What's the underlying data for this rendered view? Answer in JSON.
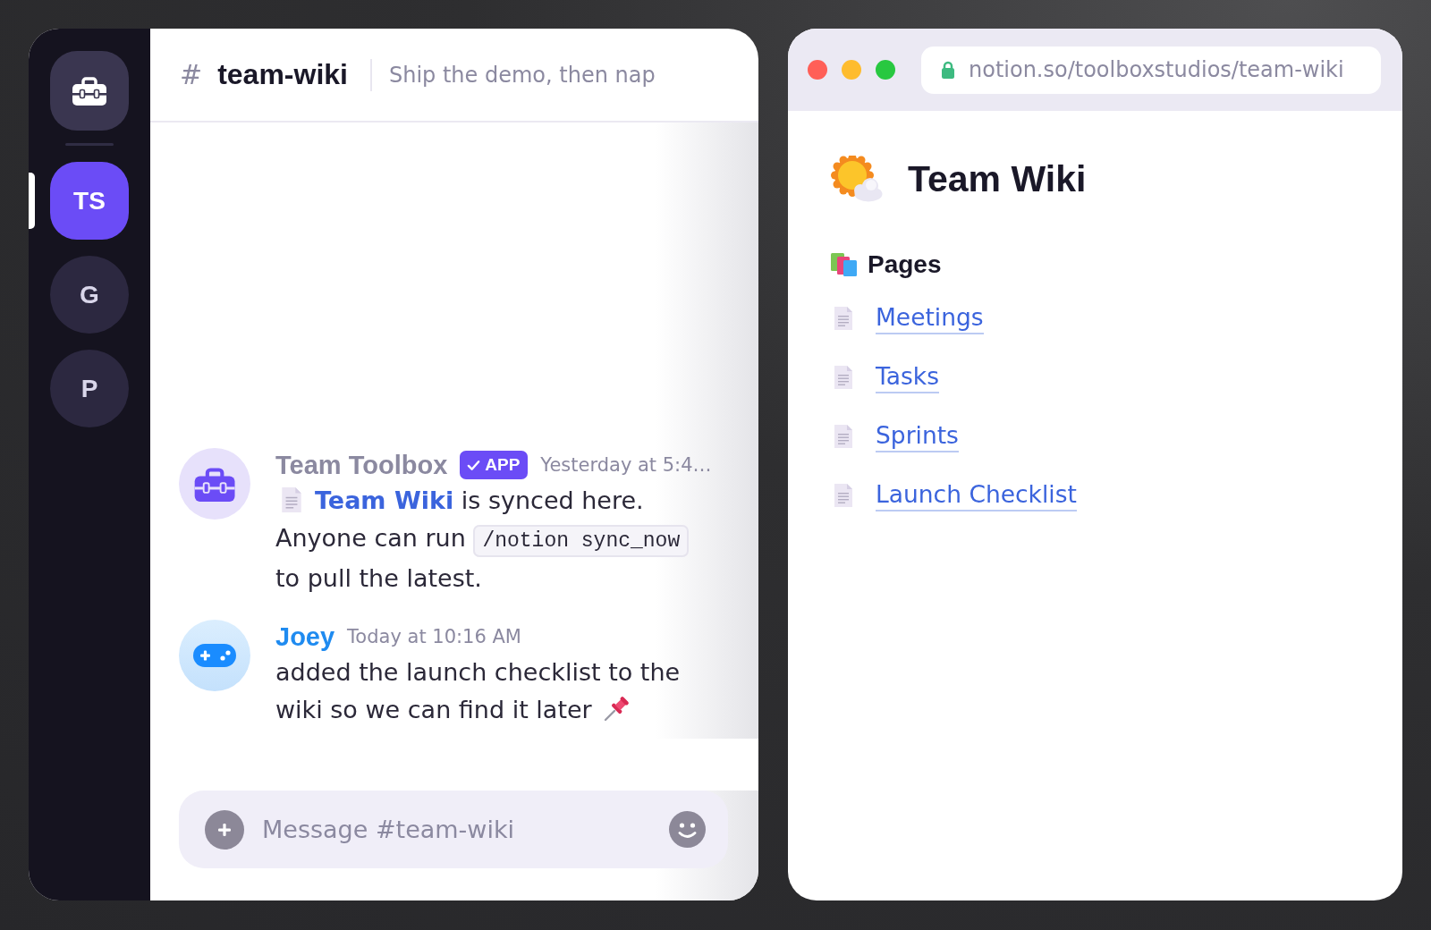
{
  "servers": [
    {
      "label": "TS",
      "selected": true
    },
    {
      "label": "G",
      "selected": false
    },
    {
      "label": "P",
      "selected": false
    }
  ],
  "channel": {
    "symbol": "#",
    "name": "team-wiki",
    "topic": "Ship the demo, then nap"
  },
  "messages": [
    {
      "kind": "bot",
      "author": "Team Toolbox",
      "color": "#8b89a0",
      "badge": "APP",
      "timestamp": "Yesterday at 5:4…",
      "lines": [
        [
          {
            "kind": "page_link",
            "text": "Team Wiki"
          },
          {
            "kind": "text",
            "text": " is synced here."
          }
        ],
        [
          {
            "kind": "text",
            "text": "Anyone can run "
          },
          {
            "kind": "code",
            "text": "/notion sync_now"
          }
        ],
        [
          {
            "kind": "text",
            "text": "to pull the latest."
          }
        ]
      ]
    },
    {
      "kind": "user",
      "author": "Joey",
      "color": "#1f8bf0",
      "timestamp": "Today at 10:16 AM",
      "lines": [
        [
          {
            "kind": "text",
            "text": "added the launch checklist to the"
          }
        ],
        [
          {
            "kind": "text",
            "text": "wiki so we can find it later"
          },
          {
            "kind": "pin"
          }
        ]
      ]
    }
  ],
  "composer": {
    "placeholder": "Message #team-wiki"
  },
  "browser": {
    "url": "notion.so/toolboxstudios/team-wiki",
    "page": {
      "title": "Team Wiki",
      "section": "Pages",
      "links": [
        "Meetings",
        "Tasks",
        "Sprints",
        "Launch Checklist"
      ]
    }
  }
}
